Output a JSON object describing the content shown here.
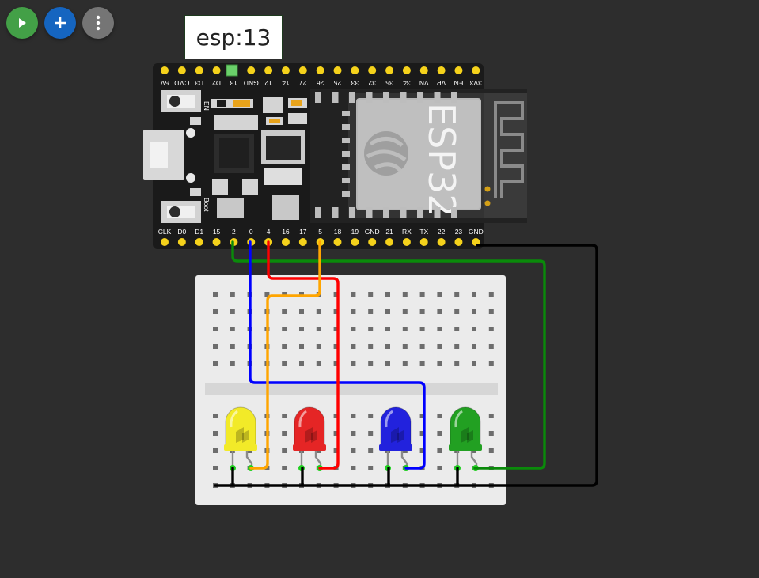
{
  "toolbar": {
    "run_color": "#43a047",
    "add_color": "#1565c0",
    "more_color": "#757575"
  },
  "tooltip": {
    "text": "esp:13"
  },
  "board": {
    "top_pins": [
      "3V3",
      "EN",
      "VP",
      "VN",
      "34",
      "35",
      "32",
      "33",
      "25",
      "26",
      "27",
      "14",
      "12",
      "GND",
      "13",
      "D2",
      "D3",
      "CMD",
      "5V"
    ],
    "bottom_pins": [
      "CLK",
      "D0",
      "D1",
      "15",
      "2",
      "0",
      "4",
      "16",
      "17",
      "5",
      "18",
      "19",
      "GND",
      "21",
      "RX",
      "TX",
      "22",
      "23",
      "GND"
    ],
    "en_label": "EN",
    "boot_label": "Boot",
    "module_label": "ESP32"
  },
  "leds": [
    {
      "color_name": "yellow",
      "color": "#f2ea28"
    },
    {
      "color_name": "red",
      "color": "#e52525"
    },
    {
      "color_name": "blue",
      "color": "#2222dd"
    },
    {
      "color_name": "green",
      "color": "#22a022"
    }
  ],
  "wires": {
    "green": "#0a8a0a",
    "blue": "#0000ff",
    "red": "#ff0000",
    "orange": "#ffa500",
    "black": "#000000"
  }
}
